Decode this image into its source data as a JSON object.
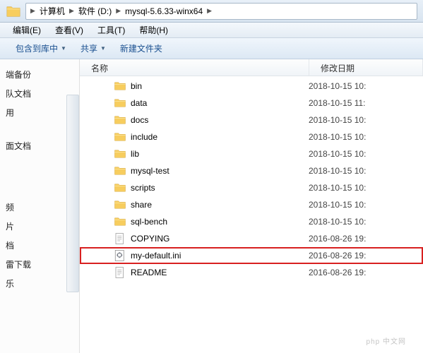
{
  "breadcrumb": {
    "items": [
      "计算机",
      "软件 (D:)",
      "mysql-5.6.33-winx64"
    ]
  },
  "menu": {
    "edit": "编辑(E)",
    "view": "查看(V)",
    "tools": "工具(T)",
    "help": "帮助(H)"
  },
  "toolbar": {
    "include": "包含到库中",
    "share": "共享",
    "new_folder": "新建文件夹"
  },
  "sidebar": {
    "items": [
      "端备份",
      "队文档",
      "用",
      "",
      "面文档",
      "",
      "",
      "",
      "频",
      "片",
      "档",
      "雷下载",
      "乐"
    ]
  },
  "columns": {
    "name": "名称",
    "modified": "修改日期"
  },
  "files": [
    {
      "name": "bin",
      "type": "folder",
      "date": "2018-10-15 10:"
    },
    {
      "name": "data",
      "type": "folder",
      "date": "2018-10-15 11:"
    },
    {
      "name": "docs",
      "type": "folder",
      "date": "2018-10-15 10:"
    },
    {
      "name": "include",
      "type": "folder",
      "date": "2018-10-15 10:"
    },
    {
      "name": "lib",
      "type": "folder",
      "date": "2018-10-15 10:"
    },
    {
      "name": "mysql-test",
      "type": "folder",
      "date": "2018-10-15 10:"
    },
    {
      "name": "scripts",
      "type": "folder",
      "date": "2018-10-15 10:"
    },
    {
      "name": "share",
      "type": "folder",
      "date": "2018-10-15 10:"
    },
    {
      "name": "sql-bench",
      "type": "folder",
      "date": "2018-10-15 10:"
    },
    {
      "name": "COPYING",
      "type": "file",
      "date": "2016-08-26 19:"
    },
    {
      "name": "my-default.ini",
      "type": "ini",
      "date": "2016-08-26 19:",
      "highlight": true
    },
    {
      "name": "README",
      "type": "file",
      "date": "2016-08-26 19:"
    }
  ],
  "watermark": "php 中文网"
}
